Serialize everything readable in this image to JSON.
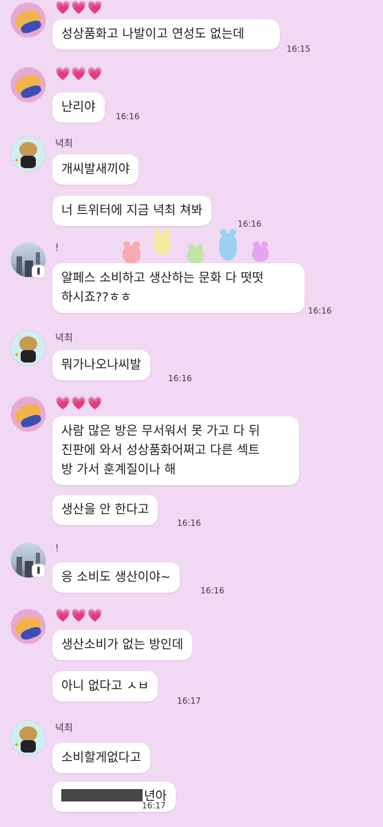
{
  "senders": {
    "hearts": "💗💗💗",
    "nyeok": "녁최",
    "excl": "!"
  },
  "messages": {
    "m1": "성상품화고 나발이고 연성도 없는데",
    "t1": "16:15",
    "m2": "난리야",
    "t2": "16:16",
    "m3": "개씨발새끼야",
    "m4": "너 트위터에 지금 녁최 쳐봐",
    "t4": "16:16",
    "m5_l1": "알페스 소비하고 생산하는 문화 다 떳떳",
    "m5_l2": "하시죠??ㅎㅎ",
    "t5": "16:16",
    "m6": "뭐가나오나씨발",
    "t6": "16:16",
    "m7_l1": "사람 많은 방은 무서워서 못 가고 다 뒤",
    "m7_l2": "진판에 와서 성상품화어쩌고 다른 섹트",
    "m7_l3": "방 가서 훈계질이나 해",
    "m8": "생산을 안 한다고",
    "t8": "16:16",
    "m9": "응 소비도 생산이야~",
    "t9": "16:16",
    "m10": "생산소비가 없는 방인데",
    "m11": "아니 없다고 ㅅㅂ",
    "t11": "16:17",
    "m12": "소비할게없다고",
    "m13_suffix": "년아",
    "t13": "16:17"
  },
  "badge_glyph": "❚",
  "colors": {
    "background": "#f2d9f3",
    "bubble": "#ffffff",
    "hearts": "#e83b96",
    "redaction": "#474747"
  }
}
